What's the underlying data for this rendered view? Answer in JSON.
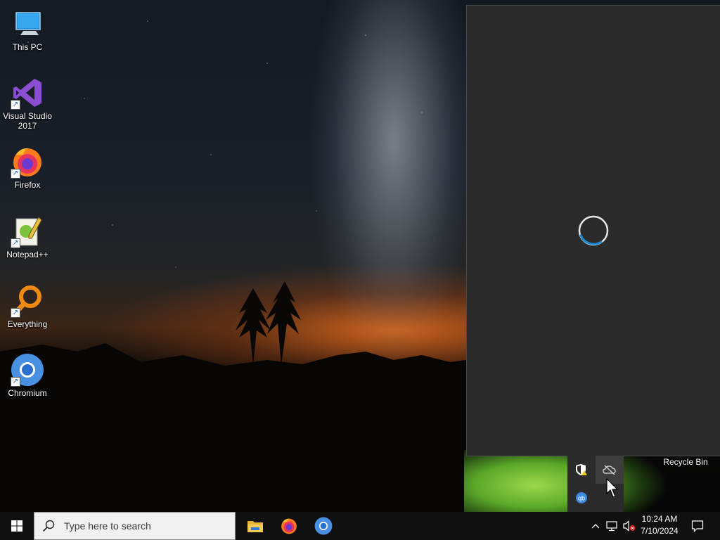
{
  "desktop": {
    "icons": [
      {
        "label": "This PC",
        "icon": "this-pc-icon"
      },
      {
        "label": "Visual Studio 2017",
        "icon": "visual-studio-icon"
      },
      {
        "label": "Firefox",
        "icon": "firefox-icon"
      },
      {
        "label": "Notepad++",
        "icon": "notepad-plus-plus-icon"
      },
      {
        "label": "Everything",
        "icon": "everything-search-icon"
      },
      {
        "label": "Chromium",
        "icon": "chromium-icon"
      }
    ],
    "recycle_bin_label": "Recycle Bin"
  },
  "loading_window": {
    "state": "loading",
    "spinner_color": "#1a8ad4"
  },
  "tray_overflow": {
    "icons": [
      "windows-security-warning-icon",
      "onedrive-offline-icon",
      "qbittorrent-icon"
    ]
  },
  "taskbar": {
    "start_icon": "windows-logo-icon",
    "search_placeholder": "Type here to search",
    "pinned_apps": [
      "file-explorer-icon",
      "firefox-icon",
      "chromium-icon"
    ],
    "tray_icons": [
      "chevron-up-icon",
      "network-icon",
      "volume-muted-icon"
    ],
    "clock": {
      "time": "10:24 AM",
      "date": "7/10/2024"
    },
    "notification_icon": "action-center-icon"
  },
  "colors": {
    "taskbar": "#101010",
    "window_bg": "#2b2b2b",
    "accent": "#1a8ad4"
  }
}
